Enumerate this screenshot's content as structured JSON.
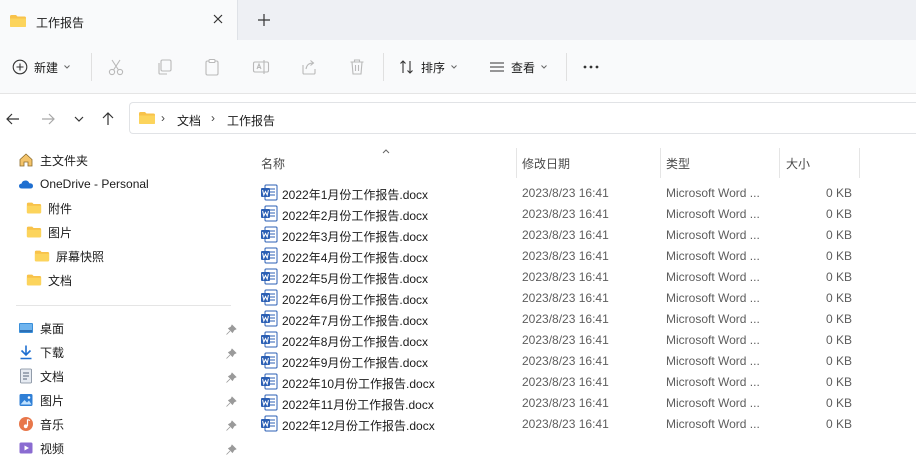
{
  "tab": {
    "title": "工作报告"
  },
  "toolbar": {
    "new_label": "新建",
    "sort_label": "排序",
    "view_label": "查看"
  },
  "address": {
    "crumbs": [
      "文档",
      "工作报告"
    ]
  },
  "nav": {
    "items": [
      {
        "label": "主文件夹",
        "icon": "home-icon"
      },
      {
        "label": "OneDrive - Personal",
        "icon": "cloud-icon"
      },
      {
        "label": "附件",
        "icon": "folder-icon"
      },
      {
        "label": "图片",
        "icon": "folder-icon"
      },
      {
        "label": "屏幕快照",
        "icon": "folder-icon"
      },
      {
        "label": "文档",
        "icon": "folder-icon"
      }
    ],
    "quick": [
      {
        "label": "桌面",
        "icon": "desktop-icon"
      },
      {
        "label": "下载",
        "icon": "download-icon"
      },
      {
        "label": "文档",
        "icon": "document-icon"
      },
      {
        "label": "图片",
        "icon": "pictures-icon"
      },
      {
        "label": "音乐",
        "icon": "music-icon"
      },
      {
        "label": "视频",
        "icon": "video-icon"
      }
    ]
  },
  "columns": {
    "name": "名称",
    "modified": "修改日期",
    "type": "类型",
    "size": "大小"
  },
  "files": [
    {
      "name": "2022年1月份工作报告.docx",
      "modified": "2023/8/23 16:41",
      "type": "Microsoft Word ...",
      "size": "0 KB"
    },
    {
      "name": "2022年2月份工作报告.docx",
      "modified": "2023/8/23 16:41",
      "type": "Microsoft Word ...",
      "size": "0 KB"
    },
    {
      "name": "2022年3月份工作报告.docx",
      "modified": "2023/8/23 16:41",
      "type": "Microsoft Word ...",
      "size": "0 KB"
    },
    {
      "name": "2022年4月份工作报告.docx",
      "modified": "2023/8/23 16:41",
      "type": "Microsoft Word ...",
      "size": "0 KB"
    },
    {
      "name": "2022年5月份工作报告.docx",
      "modified": "2023/8/23 16:41",
      "type": "Microsoft Word ...",
      "size": "0 KB"
    },
    {
      "name": "2022年6月份工作报告.docx",
      "modified": "2023/8/23 16:41",
      "type": "Microsoft Word ...",
      "size": "0 KB"
    },
    {
      "name": "2022年7月份工作报告.docx",
      "modified": "2023/8/23 16:41",
      "type": "Microsoft Word ...",
      "size": "0 KB"
    },
    {
      "name": "2022年8月份工作报告.docx",
      "modified": "2023/8/23 16:41",
      "type": "Microsoft Word ...",
      "size": "0 KB"
    },
    {
      "name": "2022年9月份工作报告.docx",
      "modified": "2023/8/23 16:41",
      "type": "Microsoft Word ...",
      "size": "0 KB"
    },
    {
      "name": "2022年10月份工作报告.docx",
      "modified": "2023/8/23 16:41",
      "type": "Microsoft Word ...",
      "size": "0 KB"
    },
    {
      "name": "2022年11月份工作报告.docx",
      "modified": "2023/8/23 16:41",
      "type": "Microsoft Word ...",
      "size": "0 KB"
    },
    {
      "name": "2022年12月份工作报告.docx",
      "modified": "2023/8/23 16:41",
      "type": "Microsoft Word ...",
      "size": "0 KB"
    }
  ],
  "colors": {
    "folder": "#f8c24a",
    "word": "#2b5fb4",
    "onedrive": "#1f6fd0"
  }
}
